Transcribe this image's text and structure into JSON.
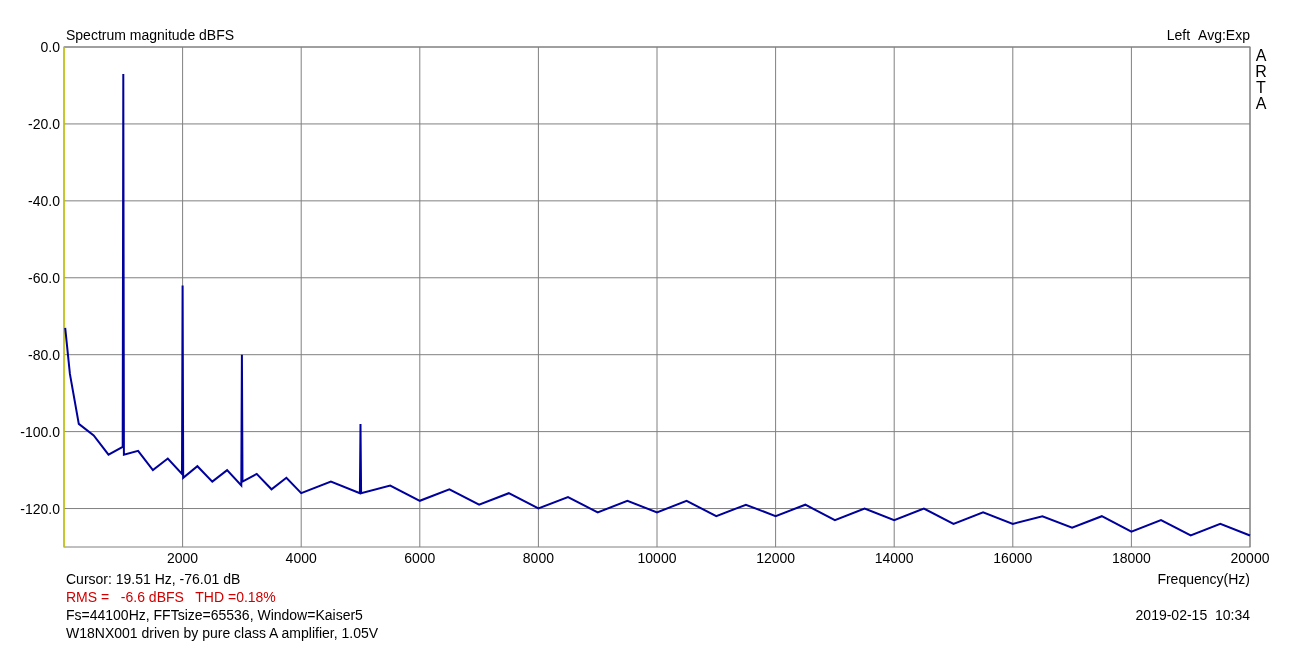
{
  "header": {
    "averaging": "Avg:Exp",
    "brand": "ARTA"
  },
  "chart_data": {
    "type": "line",
    "title": "Spectrum magnitude dBFS",
    "xlabel": "Frequency(Hz)",
    "xlim": [
      0,
      20000
    ],
    "ylim": [
      -130,
      0
    ],
    "grid": true,
    "xticks": [
      2000,
      4000,
      6000,
      8000,
      10000,
      12000,
      14000,
      16000,
      18000,
      20000
    ],
    "yticks": [
      {
        "value": 0,
        "label": "0.0"
      },
      {
        "value": -20,
        "label": "-20.0"
      },
      {
        "value": -40,
        "label": "-40.0"
      },
      {
        "value": -60,
        "label": "-60.0"
      },
      {
        "value": -80,
        "label": "-80.0"
      },
      {
        "value": -100,
        "label": "-100.0"
      },
      {
        "value": -120,
        "label": "-120.0"
      }
    ],
    "x": [
      20,
      100,
      250,
      500,
      750,
      990,
      1000,
      1010,
      1250,
      1500,
      1750,
      1990,
      2000,
      2010,
      2250,
      2500,
      2750,
      2990,
      3000,
      3010,
      3250,
      3500,
      3750,
      4000,
      4500,
      4990,
      5000,
      5010,
      5500,
      6000,
      6500,
      7000,
      7500,
      8000,
      8500,
      9000,
      9500,
      10000,
      10500,
      11000,
      11500,
      12000,
      12500,
      13000,
      13500,
      14000,
      14500,
      15000,
      15500,
      16000,
      16500,
      17000,
      17500,
      18000,
      18500,
      19000,
      19500,
      20000
    ],
    "series": [
      {
        "name": "Left",
        "color": "#00009c",
        "values": [
          -73,
          -85,
          -98,
          -101,
          -106,
          -104,
          -7,
          -106,
          -105,
          -110,
          -107,
          -111,
          -62,
          -112,
          -109,
          -113,
          -110,
          -114,
          -80,
          -113,
          -111,
          -115,
          -112,
          -116,
          -113,
          -116,
          -98,
          -116,
          -114,
          -118,
          -115,
          -119,
          -116,
          -120,
          -117,
          -121,
          -118,
          -121,
          -118,
          -122,
          -119,
          -122,
          -119,
          -123,
          -120,
          -123,
          -120,
          -124,
          -121,
          -124,
          -122,
          -125,
          -122,
          -126,
          -123,
          -127,
          -124,
          -127
        ]
      }
    ]
  },
  "footer": {
    "cursor": "Cursor: 19.51 Hz, -76.01 dB",
    "stats": "RMS =   -6.6 dBFS   THD =0.18%",
    "fft_info": "Fs=44100Hz, FFTsize=65536, Window=Kaiser5",
    "timestamp": "2019-02-15  10:34",
    "note": "W18NX001 driven by pure class A amplifier, 1.05V"
  }
}
